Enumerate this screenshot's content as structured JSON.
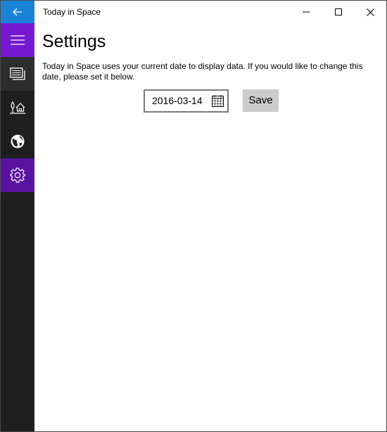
{
  "window": {
    "title": "Today in Space"
  },
  "nav": {
    "items": [
      {
        "icon": "hamburger-icon"
      },
      {
        "icon": "today-icon"
      },
      {
        "icon": "home-icon"
      },
      {
        "icon": "globe-icon"
      },
      {
        "icon": "gear-icon"
      }
    ],
    "selected_index": 4,
    "accent_color": "#7719d2",
    "selected_color": "#5a13a0"
  },
  "page": {
    "title": "Settings",
    "description": "Today in Space uses your current date to display data. If you would like to change this date, please set it below.",
    "date_value": "2016-03-14",
    "save_label": "Save"
  },
  "colors": {
    "back_button": "#1883d7",
    "nav_background": "#1f1f1f"
  }
}
